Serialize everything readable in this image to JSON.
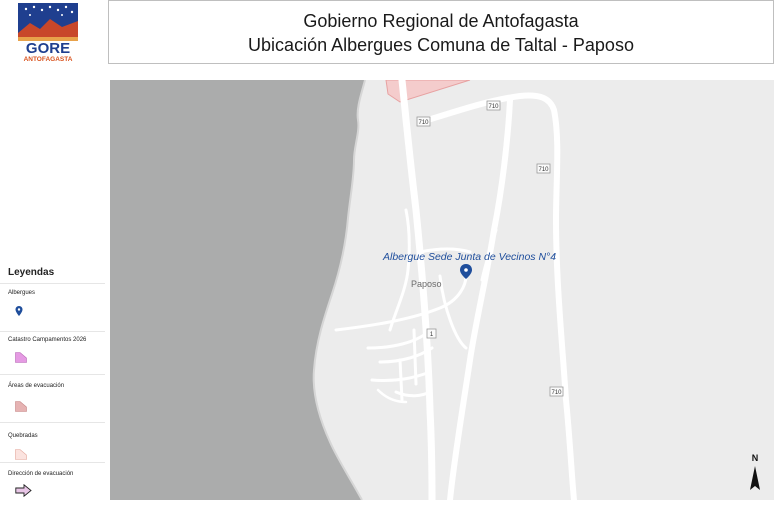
{
  "logo": {
    "text_main": "GORE",
    "text_sub": "ANTOFAGASTA"
  },
  "header": {
    "title_line1": "Gobierno Regional de Antofagasta",
    "title_line2": "Ubicación Albergues Comuna de Taltal - Paposo"
  },
  "map": {
    "shelter_label": "Albergue Sede Junta de Vecinos N°4",
    "town_label": "Paposo",
    "road_labels": [
      "710",
      "710",
      "710",
      "710",
      "1"
    ],
    "colors": {
      "sea": "#abacac",
      "land": "#ececec",
      "roads": "#ffffff",
      "accent": "#1f4e9c",
      "camp_area": "#f4cccc"
    }
  },
  "legend": {
    "title": "Leyendas",
    "items": [
      {
        "label": "Albergues",
        "symbol": "pin-icon"
      },
      {
        "label": "Catastro Campamentos 2026",
        "symbol": "campamento-swatch"
      },
      {
        "label": "Áreas de evacuación",
        "symbol": "evacuation-area-swatch"
      },
      {
        "label": "Quebradas",
        "symbol": "quebrada-swatch"
      },
      {
        "label": "Dirección de evacuación",
        "symbol": "arrow-icon"
      }
    ]
  },
  "north_arrow": {
    "label": "N"
  }
}
